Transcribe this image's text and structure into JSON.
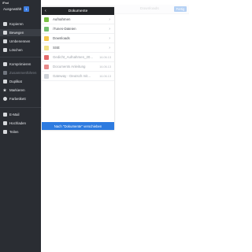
{
  "status": {
    "device": "iPad",
    "time": "17:06",
    "battery": "100%"
  },
  "sidebar": {
    "title": "Ausgewählt",
    "count": "1",
    "items": [
      {
        "label": "Kopieren",
        "icon": "copy-icon",
        "disabled": false
      },
      {
        "label": "Bewegen",
        "icon": "move-icon",
        "disabled": false,
        "selected": true
      },
      {
        "label": "Umbenennen",
        "icon": "rename-icon",
        "disabled": false
      },
      {
        "label": "Löschen",
        "icon": "trash-icon",
        "disabled": false
      },
      {
        "label": "Komprimieren",
        "icon": "compress-icon",
        "disabled": false
      },
      {
        "label": "Zusammenführen",
        "icon": "merge-icon",
        "disabled": true
      },
      {
        "label": "Duplikat",
        "icon": "duplicate-icon",
        "disabled": false
      },
      {
        "label": "Markieren",
        "icon": "star-icon",
        "disabled": false
      },
      {
        "label": "Farbetikett",
        "icon": "tag-icon",
        "disabled": false
      },
      {
        "label": "E-Mail",
        "icon": "mail-icon",
        "disabled": false
      },
      {
        "label": "Hochladen",
        "icon": "upload-icon",
        "disabled": false
      },
      {
        "label": "Teilen",
        "icon": "share-icon",
        "disabled": false
      }
    ]
  },
  "main": {
    "title": "Downloads",
    "done_label": "Fertig"
  },
  "panel": {
    "title": "Dokumente",
    "rows": [
      {
        "label": "Aufnahmen",
        "kind": "folder",
        "color": "#7ac143"
      },
      {
        "label": "iTunes-Dateien",
        "kind": "folder",
        "color": "#74c06f"
      },
      {
        "label": "Downloads",
        "kind": "folder",
        "color": "#f5c84a"
      },
      {
        "label": "SSE",
        "kind": "folder",
        "color": "#f1e083"
      },
      {
        "label": "Gedicht_Aufnahmen_20...",
        "kind": "file",
        "color": "#e66b6b",
        "date": "16.06.13",
        "muted": true
      },
      {
        "label": "Documents Anleitung",
        "kind": "file",
        "color": "#e88c8c",
        "date": "16.06.13",
        "muted": true
      },
      {
        "label": "Gateway - Deutsch mit...",
        "kind": "file",
        "color": "#cfd3d8",
        "date": "16.06.13",
        "muted": true
      }
    ],
    "footer": "Nach \"Dokumente\" verschieben"
  }
}
